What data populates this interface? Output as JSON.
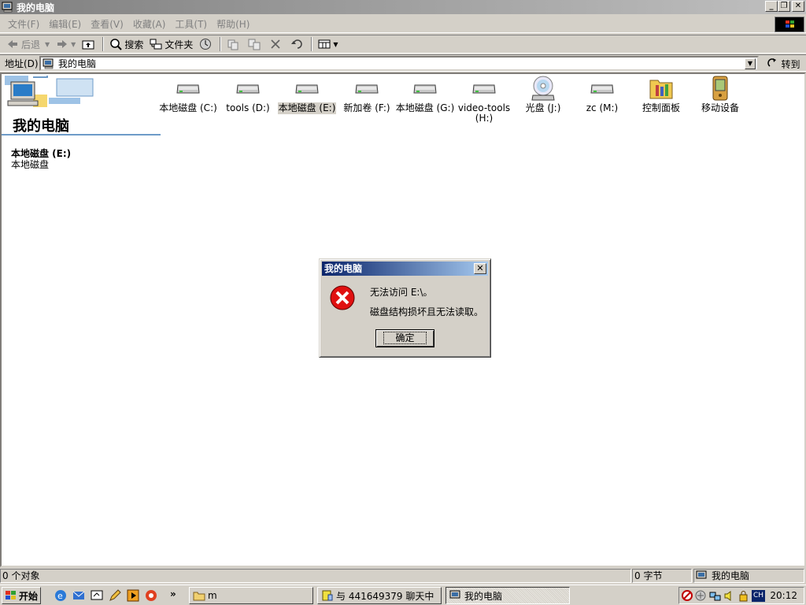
{
  "window": {
    "title": "我的电脑"
  },
  "menu": [
    "文件(F)",
    "编辑(E)",
    "查看(V)",
    "收藏(A)",
    "工具(T)",
    "帮助(H)"
  ],
  "toolbar": {
    "back": "后退",
    "search": "搜索",
    "folders": "文件夹"
  },
  "address": {
    "label": "地址(D)",
    "value": "我的电脑",
    "go": "转到"
  },
  "sidebar": {
    "title": "我的电脑",
    "selected_name": "本地磁盘 (E:)",
    "selected_desc": "本地磁盘"
  },
  "drives": [
    {
      "label": "本地磁盘 (C:)",
      "icon": "hard-drive-icon"
    },
    {
      "label": "tools (D:)",
      "icon": "hard-drive-icon"
    },
    {
      "label": "本地磁盘 (E:)",
      "icon": "hard-drive-icon",
      "selected": true
    },
    {
      "label": "新加卷 (F:)",
      "icon": "hard-drive-icon"
    },
    {
      "label": "本地磁盘 (G:)",
      "icon": "hard-drive-icon"
    },
    {
      "label": "video-tools (H:)",
      "icon": "hard-drive-icon"
    },
    {
      "label": "光盘 (J:)",
      "icon": "cd-drive-icon"
    },
    {
      "label": "zc (M:)",
      "icon": "hard-drive-icon"
    },
    {
      "label": "控制面板",
      "icon": "control-panel-icon"
    },
    {
      "label": "移动设备",
      "icon": "mobile-device-icon"
    }
  ],
  "dialog": {
    "title": "我的电脑",
    "message1": "无法访问 E:\\。",
    "message2": "磁盘结构损坏且无法读取。",
    "ok": "确定"
  },
  "status": {
    "objects": "0 个对象",
    "size": "0 字节",
    "zone": "我的电脑"
  },
  "taskbar": {
    "start": "开始",
    "more": "»",
    "tasks": [
      {
        "label": "m"
      },
      {
        "label": "与 441649379 聊天中"
      },
      {
        "label": "我的电脑",
        "active": true
      }
    ],
    "clock": "20:12",
    "lang": "CH"
  },
  "colors": {
    "titlebar_active": "#0a246a",
    "face": "#d4d0c8",
    "banner_line": "#6e9bc8"
  }
}
